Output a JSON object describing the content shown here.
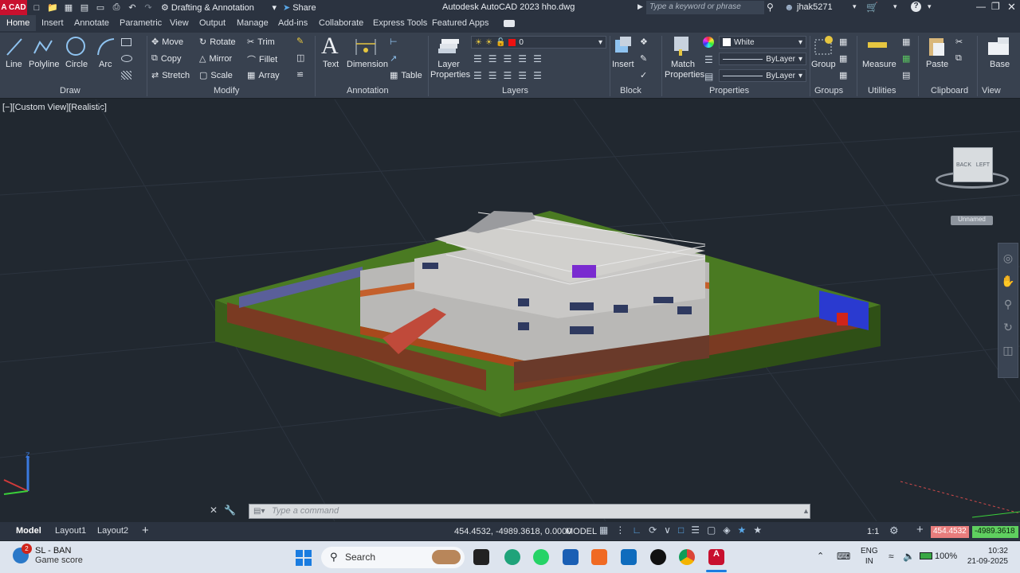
{
  "titlebar": {
    "logo_text": "A CAD",
    "workspace": "Drafting & Annotation",
    "share": "Share",
    "title": "Autodesk AutoCAD 2023    hho.dwg",
    "search_placeholder": "Type a keyword or phrase",
    "user": "jhak5271"
  },
  "ribbon_tabs": [
    "Home",
    "Insert",
    "Annotate",
    "Parametric",
    "View",
    "Output",
    "Manage",
    "Add-ins",
    "Collaborate",
    "Express Tools",
    "Featured Apps"
  ],
  "draw": {
    "title": "Draw",
    "line": "Line",
    "polyline": "Polyline",
    "circle": "Circle",
    "arc": "Arc"
  },
  "modify": {
    "title": "Modify",
    "move": "Move",
    "rotate": "Rotate",
    "trim": "Trim",
    "copy": "Copy",
    "mirror": "Mirror",
    "fillet": "Fillet",
    "stretch": "Stretch",
    "scale": "Scale",
    "array": "Array"
  },
  "annotation": {
    "title": "Annotation",
    "text": "Text",
    "dimension": "Dimension",
    "table": "Table"
  },
  "layers": {
    "title": "Layers",
    "layer_properties": "Layer Properties",
    "current_layer": "0"
  },
  "block": {
    "title": "Block",
    "insert": "Insert"
  },
  "properties": {
    "title": "Properties",
    "match": "Match Properties",
    "color": "White",
    "linetype": "ByLayer",
    "lineweight": "ByLayer"
  },
  "groups": {
    "title": "Groups",
    "group": "Group"
  },
  "utilities": {
    "title": "Utilities",
    "measure": "Measure"
  },
  "clipboard": {
    "title": "Clipboard",
    "paste": "Paste"
  },
  "view": {
    "title": "View",
    "base": "Base"
  },
  "viewport": {
    "label": "[−][Custom View][Realistic]",
    "viewcube_top": "BACK",
    "viewcube_side": "LEFT",
    "ucs_label": "Unnamed"
  },
  "command": {
    "placeholder": "Type a command"
  },
  "statusbar": {
    "layouts": [
      "Model",
      "Layout1",
      "Layout2"
    ],
    "coords": "454.4532, -4989.3618, 0.0000",
    "model": "MODEL",
    "scale": "1:1",
    "dyn_x": "454.4532",
    "dyn_y": "-4989.3618"
  },
  "taskbar": {
    "widget_badge": "2",
    "widget_title": "SL - BAN",
    "widget_sub": "Game score",
    "search": "Search",
    "lang_1": "ENG",
    "lang_2": "IN",
    "battery": "100%",
    "time": "10:32",
    "date": "21-09-2025"
  },
  "colors": {
    "accent_red": "#c8102e",
    "ribbon_bg": "#38414f",
    "viewport_bg": "#212830",
    "grass": "#3f6b1e",
    "brick": "#7a3a22"
  }
}
